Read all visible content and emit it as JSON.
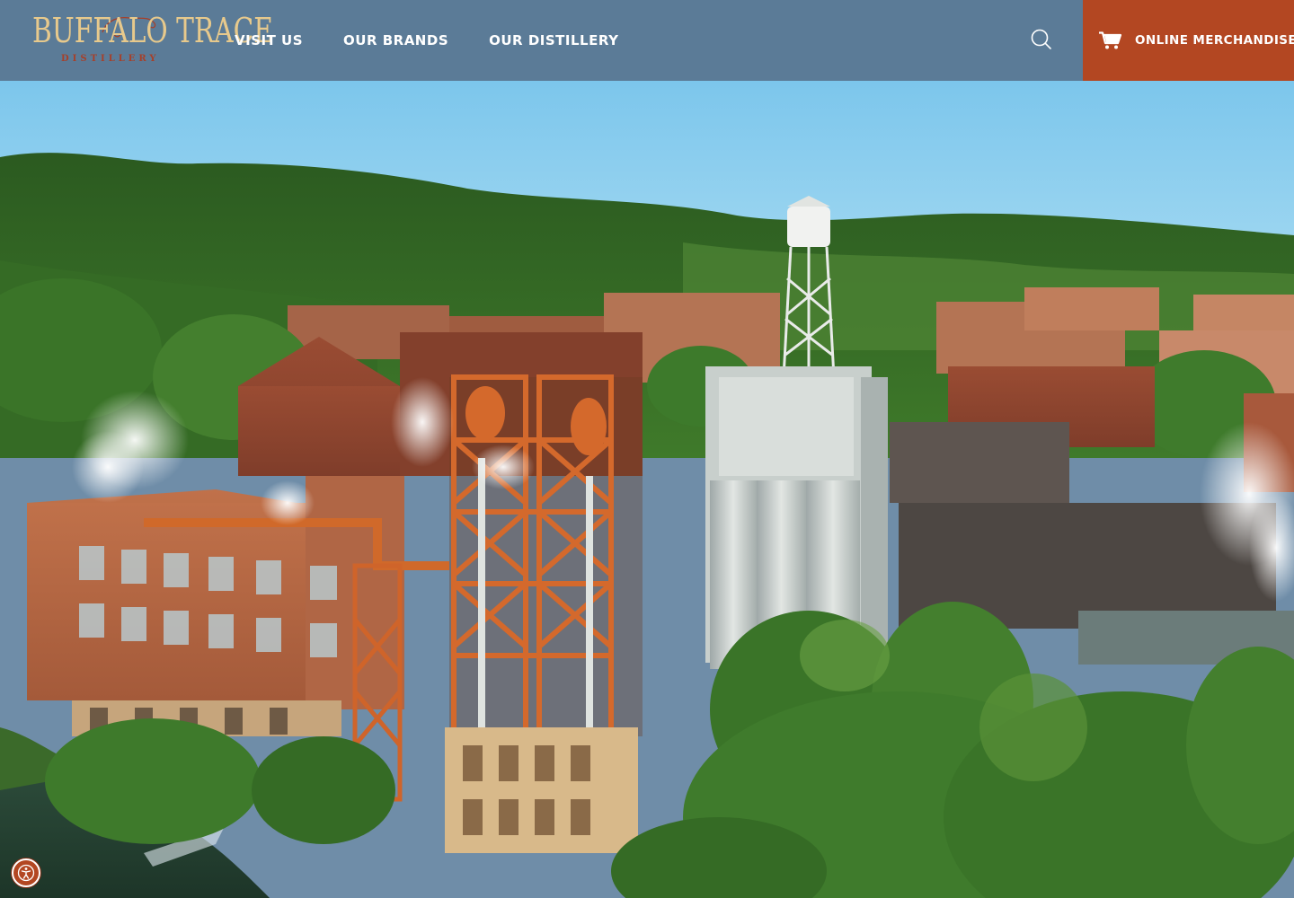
{
  "brand": {
    "logo_text": "BUFFALO TRACE",
    "logo_subtext": "DISTILLERY",
    "logo_gold": "#e7c98c",
    "logo_red": "#a6402a"
  },
  "nav": {
    "items": [
      {
        "label": "VISIT US"
      },
      {
        "label": "OUR BRANDS"
      },
      {
        "label": "OUR DISTILLERY"
      }
    ]
  },
  "header": {
    "background": "#5b7b97",
    "search_icon": "search-icon",
    "cart_icon": "cart-icon",
    "merch_label": "ONLINE MERCHANDISE",
    "merch_color": "#b34722"
  },
  "hero": {
    "scene": "aerial-distillery-photo"
  },
  "accessibility": {
    "icon": "accessibility-icon"
  }
}
